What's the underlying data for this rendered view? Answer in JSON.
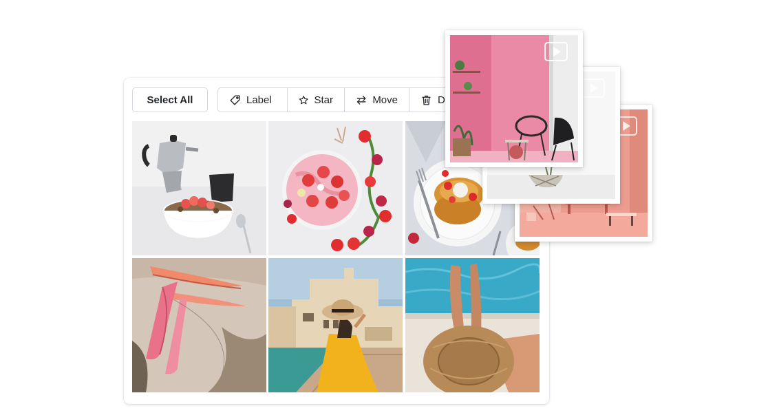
{
  "toolbar": {
    "select_all_label": "Select All",
    "label_label": "Label",
    "star_label": "Star",
    "move_label": "Move",
    "delete_label": "De",
    "icons": [
      "tag-icon",
      "star-icon",
      "swap-arrows-icon",
      "trash-icon"
    ]
  },
  "grid": {
    "photos": [
      "moka-pot-and-granola-bowl",
      "strawberry-smoothie-bowl",
      "pancakes-with-strawberries",
      "pink-kayaks-on-sand",
      "woman-in-yellow-dress-with-hat",
      "legs-by-pool-with-straw-hat"
    ]
  },
  "video_stack": {
    "cards": [
      "pink-room-with-chairs",
      "white-room-with-plant",
      "coral-room-with-bench"
    ],
    "play_icon": "play-icon"
  },
  "colors": {
    "border": "#d5d8dc",
    "text": "#1f2328",
    "pink_wall": "#e47a9a",
    "coral_wall": "#e9998b"
  }
}
